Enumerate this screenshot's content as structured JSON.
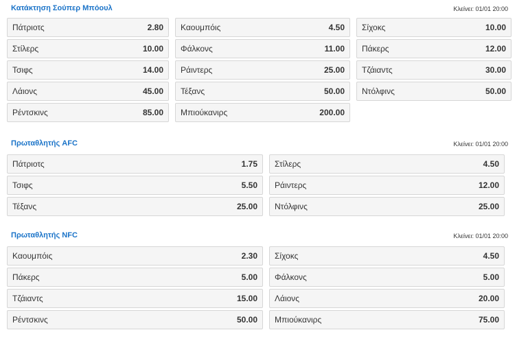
{
  "markets": [
    {
      "title": "Κατάκτηση Σούπερ Μπόουλ",
      "closes": "Κλείνει: 01/01 20:00",
      "selections": [
        {
          "name": "Πάτριοτς",
          "odd": "2.80"
        },
        {
          "name": "Καουμπόις",
          "odd": "4.50"
        },
        {
          "name": "Σίχοκς",
          "odd": "10.00"
        },
        {
          "name": "Στίλερς",
          "odd": "10.00"
        },
        {
          "name": "Φάλκονς",
          "odd": "11.00"
        },
        {
          "name": "Πάκερς",
          "odd": "12.00"
        },
        {
          "name": "Τσιφς",
          "odd": "14.00"
        },
        {
          "name": "Ράιντερς",
          "odd": "25.00"
        },
        {
          "name": "Τζάιαντς",
          "odd": "30.00"
        },
        {
          "name": "Λάιονς",
          "odd": "45.00"
        },
        {
          "name": "Τέξανς",
          "odd": "50.00"
        },
        {
          "name": "Ντόλφινς",
          "odd": "50.00"
        },
        {
          "name": "Ρέντσκινς",
          "odd": "85.00"
        },
        {
          "name": "Μπιούκανιρς",
          "odd": "200.00"
        }
      ]
    },
    {
      "title": "Πρωταθλητής AFC",
      "closes": "Κλείνει: 01/01 20:00",
      "selections": [
        {
          "name": "Πάτριοτς",
          "odd": "1.75"
        },
        {
          "name": "Στίλερς",
          "odd": "4.50"
        },
        {
          "name": "Τσιφς",
          "odd": "5.50"
        },
        {
          "name": "Ράιντερς",
          "odd": "12.00"
        },
        {
          "name": "Τέξανς",
          "odd": "25.00"
        },
        {
          "name": "Ντόλφινς",
          "odd": "25.00"
        }
      ]
    },
    {
      "title": "Πρωταθλητής NFC",
      "closes": "Κλείνει: 01/01 20:00",
      "selections": [
        {
          "name": "Καουμπόις",
          "odd": "2.30"
        },
        {
          "name": "Σίχοκς",
          "odd": "4.50"
        },
        {
          "name": "Πάκερς",
          "odd": "5.00"
        },
        {
          "name": "Φάλκονς",
          "odd": "5.00"
        },
        {
          "name": "Τζάιαντς",
          "odd": "15.00"
        },
        {
          "name": "Λάιονς",
          "odd": "20.00"
        },
        {
          "name": "Ρέντσκινς",
          "odd": "50.00"
        },
        {
          "name": "Μπιούκανιρς",
          "odd": "75.00"
        }
      ]
    }
  ]
}
